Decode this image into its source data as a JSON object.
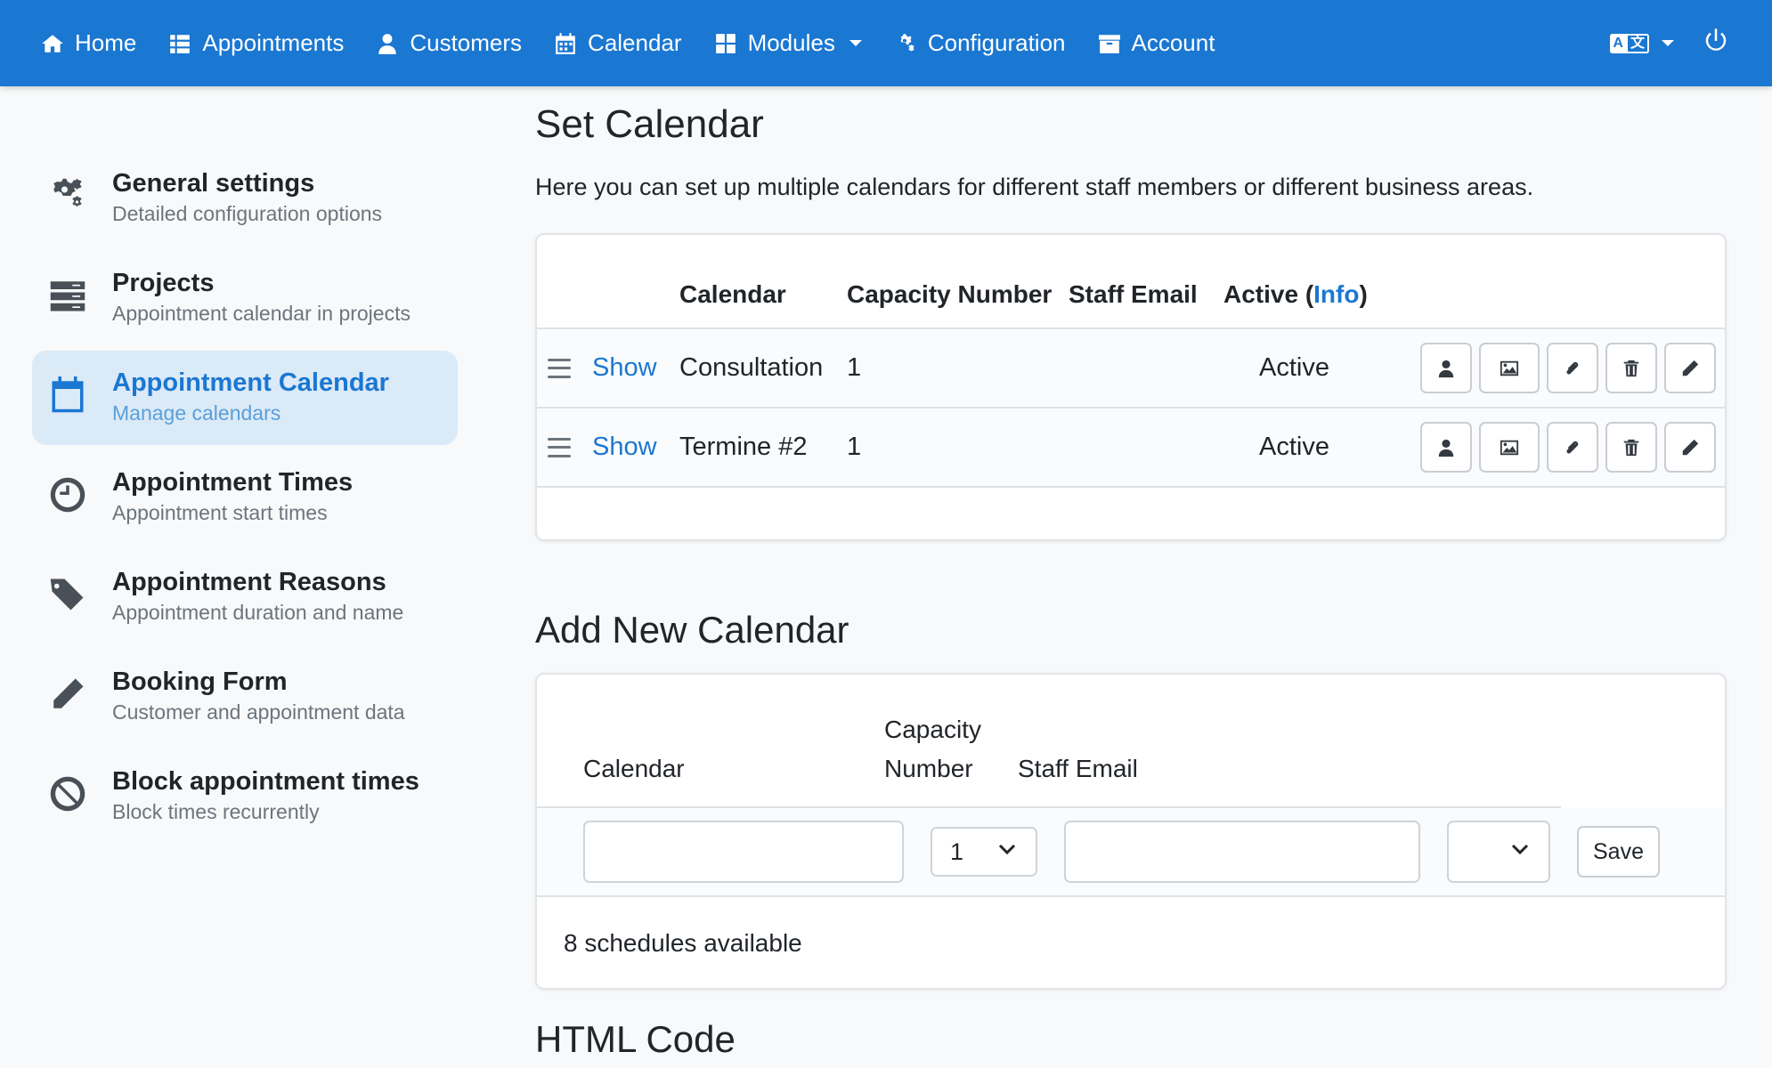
{
  "colors": {
    "accent": "#1a77d2",
    "active_bg": "#dbeaf7"
  },
  "nav": {
    "items": [
      {
        "label": "Home",
        "icon": "home-icon"
      },
      {
        "label": "Appointments",
        "icon": "list-icon"
      },
      {
        "label": "Customers",
        "icon": "user-icon"
      },
      {
        "label": "Calendar",
        "icon": "calendar-icon"
      },
      {
        "label": "Modules",
        "icon": "grid-icon"
      },
      {
        "label": "Configuration",
        "icon": "cogs-icon"
      },
      {
        "label": "Account",
        "icon": "archive-icon"
      }
    ],
    "language_icon": "translate-icon",
    "power_icon": "power-icon"
  },
  "sidebar": {
    "items": [
      {
        "title": "General settings",
        "subtitle": "Detailed configuration options",
        "icon": "cogs-icon"
      },
      {
        "title": "Projects",
        "subtitle": "Appointment calendar in projects",
        "icon": "server-icon"
      },
      {
        "title": "Appointment Calendar",
        "subtitle": "Manage calendars",
        "icon": "calendar-icon"
      },
      {
        "title": "Appointment Times",
        "subtitle": "Appointment start times",
        "icon": "clock-icon"
      },
      {
        "title": "Appointment Reasons",
        "subtitle": "Appointment duration and name",
        "icon": "tags-icon"
      },
      {
        "title": "Booking Form",
        "subtitle": "Customer and appointment data",
        "icon": "pencil-icon"
      },
      {
        "title": "Block appointment times",
        "subtitle": "Block times recurrently",
        "icon": "ban-icon"
      }
    ]
  },
  "main": {
    "title": "Set Calendar",
    "lead": "Here you can set up multiple calendars for different staff members or different business areas.",
    "table": {
      "headers": {
        "calendar": "Calendar",
        "capacity": "Capacity Number",
        "email": "Staff Email",
        "active_prefix": "Active (",
        "info": "Info",
        "active_suffix": ")"
      },
      "rows": [
        {
          "show": "Show",
          "calendar": "Consultation",
          "capacity": "1",
          "email": "",
          "active": "Active"
        },
        {
          "show": "Show",
          "calendar": "Termine #2",
          "capacity": "1",
          "email": "",
          "active": "Active"
        }
      ]
    },
    "add": {
      "title": "Add New Calendar",
      "headers": {
        "calendar": "Calendar",
        "capacity_line1": "Capacity",
        "capacity_line2": "Number",
        "email": "Staff Email"
      },
      "capacity_value": "1",
      "calendar_value": "",
      "email_value": "",
      "save": "Save",
      "available": "8 schedules available"
    },
    "html_code_title": "HTML Code"
  }
}
